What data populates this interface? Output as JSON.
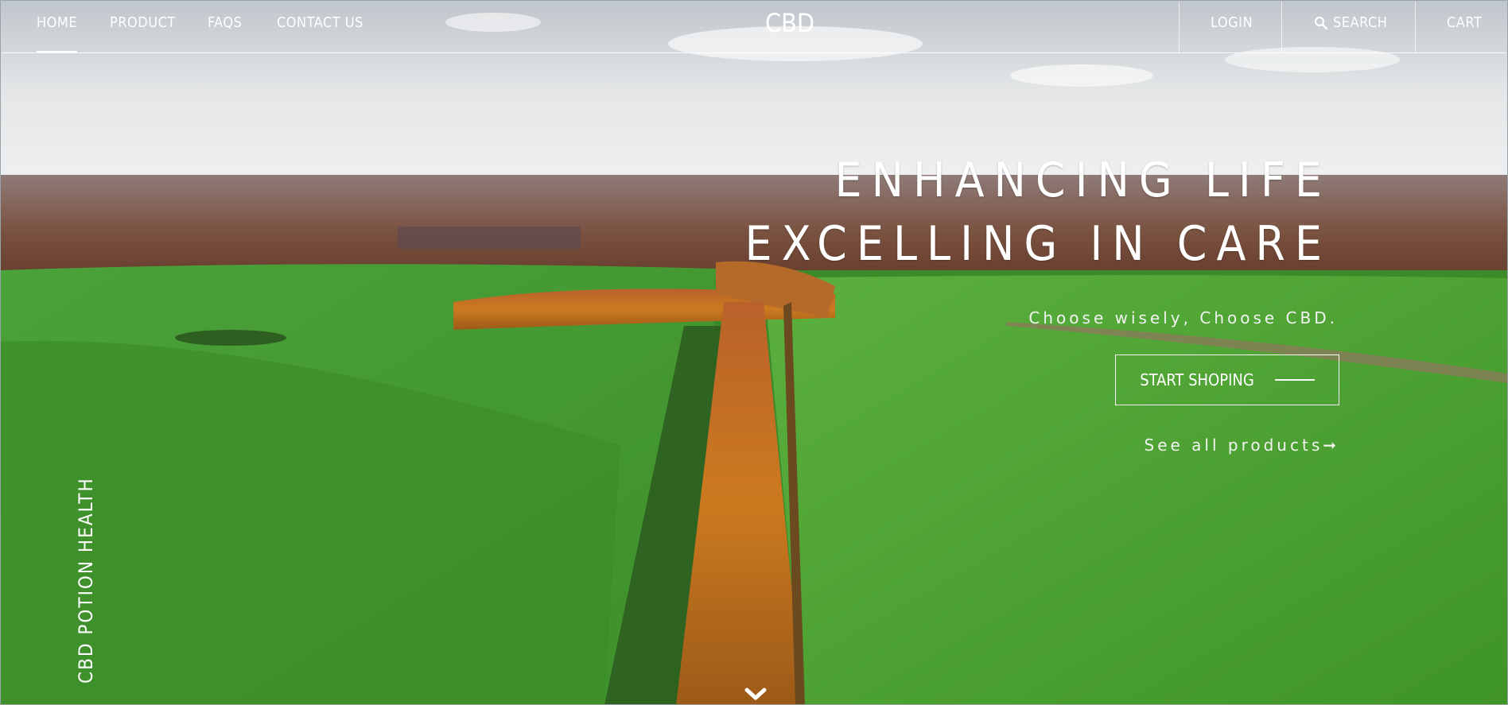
{
  "nav": {
    "left_items": [
      {
        "label": "HOME",
        "active": true
      },
      {
        "label": "PRODUCT"
      },
      {
        "label": "FAQS"
      },
      {
        "label": "CONTACT US"
      }
    ],
    "brand": "CBD",
    "right_items": [
      {
        "label": "LOGIN"
      },
      {
        "label": "SEARCH",
        "icon": "search-icon"
      },
      {
        "label": "CART"
      }
    ]
  },
  "hero": {
    "headline_line1": "ENHANCING LIFE",
    "headline_line2": "EXCELLING IN CARE",
    "tagline": "Choose wisely, Choose CBD.",
    "cta_label": "START SHOPING",
    "see_all": "See all products",
    "side_text": "CBD POTION HEALTH",
    "scroll_icon": "chevron-down-icon"
  }
}
